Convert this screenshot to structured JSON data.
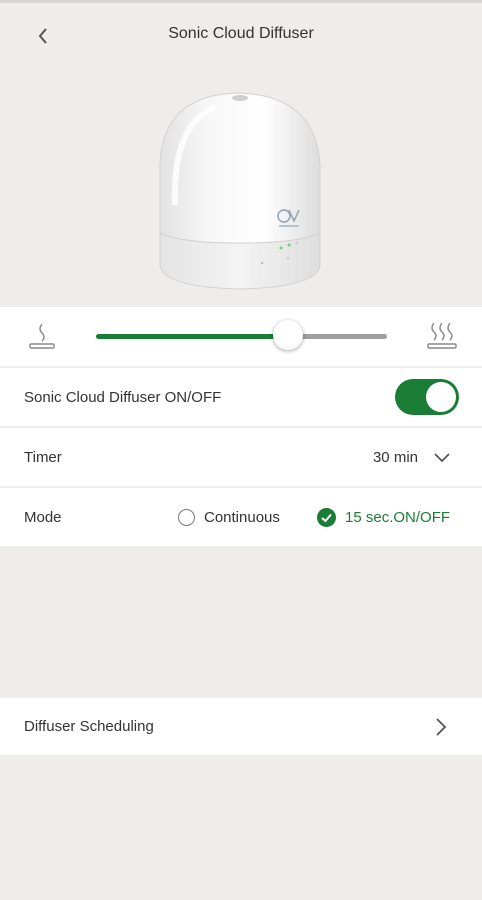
{
  "header": {
    "title": "Sonic Cloud Diffuser"
  },
  "icons": {
    "back": "chevron-left-icon",
    "mist_low": "mist-low-icon",
    "mist_high": "mist-high-icon",
    "timer_dropdown": "chevron-down-icon",
    "scheduling": "chevron-right-icon",
    "mode_selected": "check-circle-icon"
  },
  "intensity": {
    "level": 0.66
  },
  "power": {
    "label": "Sonic Cloud Diffuser ON/OFF",
    "on": true
  },
  "timer": {
    "label": "Timer",
    "value": "30 min"
  },
  "mode": {
    "label": "Mode",
    "options": [
      {
        "label": "Continuous",
        "selected": false
      },
      {
        "label": "15 sec.ON/OFF",
        "selected": true
      }
    ]
  },
  "scheduling": {
    "label": "Diffuser Scheduling"
  },
  "colors": {
    "accent": "#1a7d35",
    "background": "#efecec",
    "panel": "#ffffff"
  }
}
